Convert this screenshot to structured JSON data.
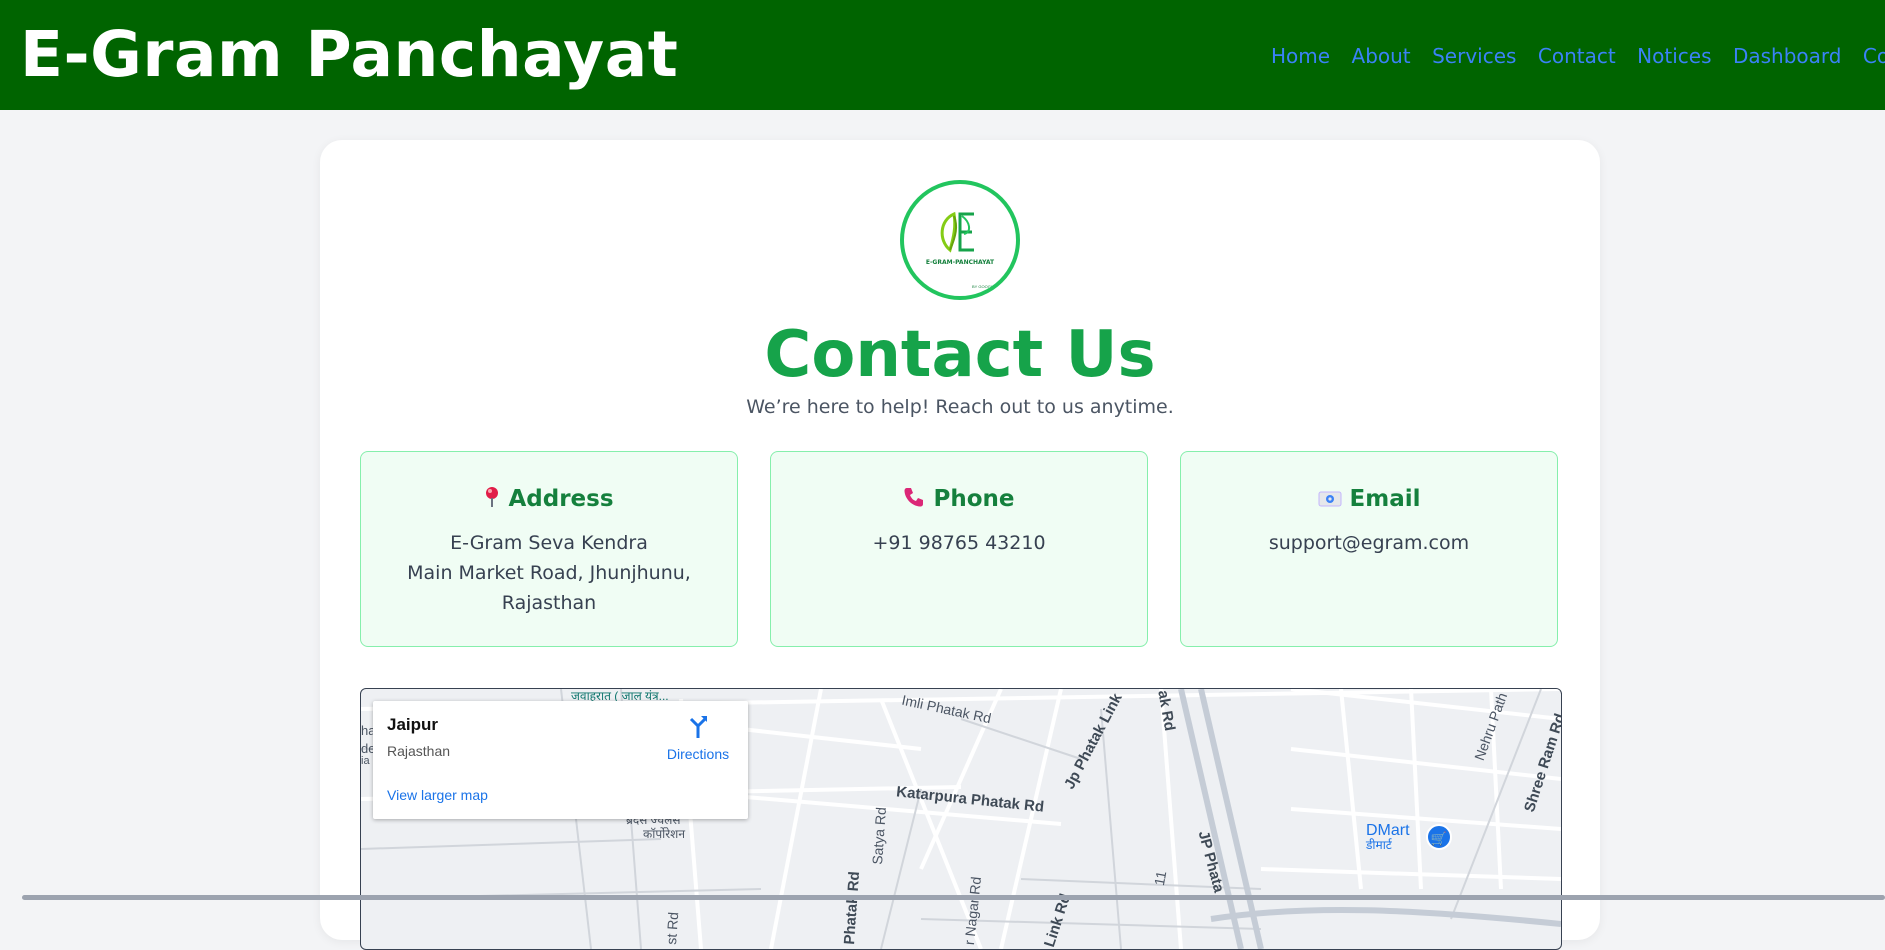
{
  "header": {
    "brand": "E-Gram Panchayat",
    "nav": [
      "Home",
      "About",
      "Services",
      "Contact",
      "Notices",
      "Dashboard",
      "Complai"
    ]
  },
  "logo": {
    "text": "E-GRAM-PANCHAYAT",
    "sub": "BY GOOGLE"
  },
  "contact": {
    "title": "Contact Us",
    "subtitle": "We’re here to help! Reach out to us anytime.",
    "address": {
      "icon": "pin-icon",
      "title": "Address",
      "line1": "E-Gram Seva Kendra",
      "line2": "Main Market Road, Jhunjhunu,",
      "line3": "Rajasthan"
    },
    "phone": {
      "icon": "phone-icon",
      "title": "Phone",
      "value": "+91 98765 43210"
    },
    "email": {
      "icon": "email-icon",
      "title": "Email",
      "value": "support@egram.com"
    }
  },
  "map": {
    "city": "Jaipur",
    "state": "Rajasthan",
    "directions": "Directions",
    "view_larger": "View larger map",
    "labels": {
      "imli": "Imli Phatak Rd",
      "katarpura": "Katarpura Phatak Rd",
      "jp_link": "Jp Phatak Link",
      "ak_rd": "ak Rd",
      "jp_phata": "JP Phata",
      "nehru": "Nehru Path",
      "shree_ram": "Shree Ram Rd",
      "phatak_rd": "Phatak Rd",
      "satya": "Satya Rd",
      "nagar": "r Nagar Rd",
      "link_rd": "Link Rd",
      "st_rd": "st Rd",
      "eleven": "11",
      "hindi_top": "जवाहरात ( जाल यंत्र...",
      "hindi_bottom1": "ब्रदस ज्वेलर्स",
      "hindi_bottom2": "कॉर्पोरेशन",
      "edge1": "ha",
      "edge2": "de",
      "edge3": "ia",
      "dmart": "DMart",
      "dmart_hi": "डीमार्ट"
    }
  }
}
